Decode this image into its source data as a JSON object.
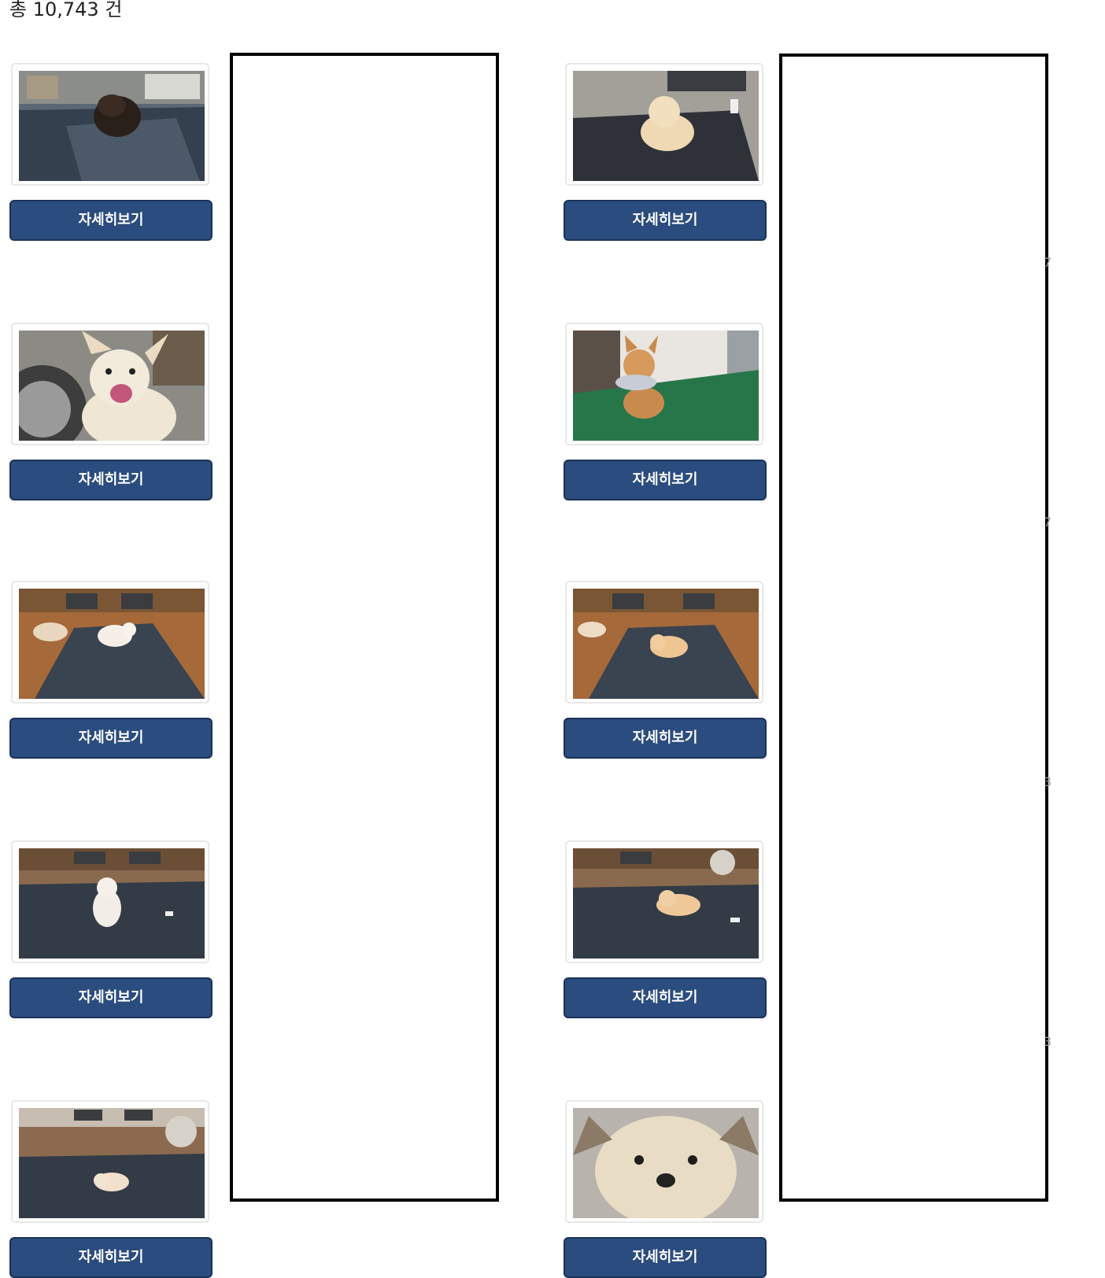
{
  "summary": {
    "total_label": "총 10,743 건"
  },
  "detail_label": "자세히보기",
  "listings": [
    {
      "id": "card-1",
      "photo": "black-poodle-on-mat"
    },
    {
      "id": "card-2",
      "photo": "white-dog-by-tire"
    },
    {
      "id": "card-3",
      "photo": "white-kitten-on-towel"
    },
    {
      "id": "card-4",
      "photo": "white-kitten-standing"
    },
    {
      "id": "card-5",
      "photo": "cream-kitten-on-towel"
    },
    {
      "id": "card-6",
      "photo": "cream-puppy-on-mat"
    },
    {
      "id": "card-7",
      "photo": "shiba-on-turf"
    },
    {
      "id": "card-8",
      "photo": "orange-kitten-on-towel"
    },
    {
      "id": "card-9",
      "photo": "orange-kitten-lying"
    },
    {
      "id": "card-10",
      "photo": "cream-dog-closeup"
    }
  ],
  "edge_glyphs": [
    "7",
    "7",
    "3",
    "3"
  ]
}
